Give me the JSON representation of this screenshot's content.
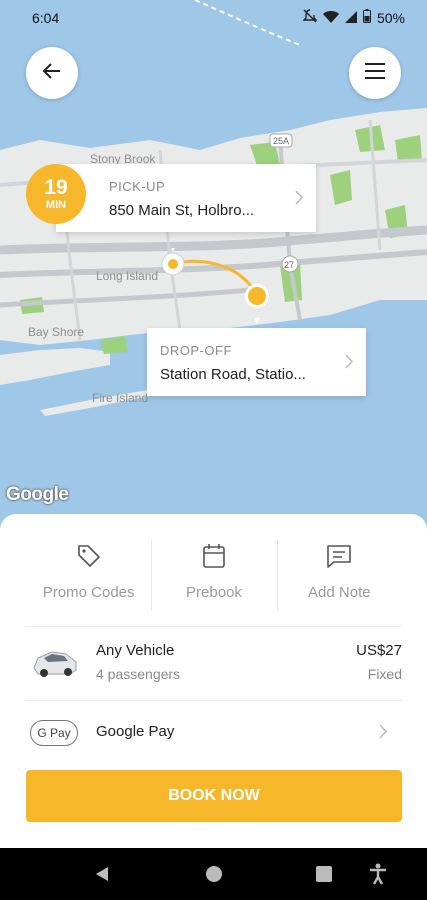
{
  "status_bar": {
    "time": "6:04",
    "battery": "50%"
  },
  "trip": {
    "eta_value": "19",
    "eta_unit": "MIN",
    "pickup_label": "PICK-UP",
    "pickup_address": "850 Main St, Holbro...",
    "dropoff_label": "DROP-OFF",
    "dropoff_address": "Station Road, Statio..."
  },
  "map": {
    "attribution": "Google",
    "place_labels": [
      "Stony Brook",
      "Long Island",
      "Bay Shore",
      "Fire Island"
    ],
    "route_shields": [
      "25A",
      "27"
    ],
    "colors": {
      "water": "#9fc7e8",
      "land": "#e9eaea",
      "parks": "#9dd17d",
      "roads": "#c5c8cc",
      "route": "#f6b72b"
    }
  },
  "actions": [
    {
      "label": "Promo Codes",
      "icon": "tag-icon"
    },
    {
      "label": "Prebook",
      "icon": "calendar-icon"
    },
    {
      "label": "Add Note",
      "icon": "note-icon"
    }
  ],
  "vehicle": {
    "name": "Any Vehicle",
    "passengers": "4 passengers",
    "price": "US$27",
    "price_type": "Fixed",
    "icon": "car-icon"
  },
  "payment": {
    "badge": "G Pay",
    "name": "Google Pay"
  },
  "book_button": "BOOK NOW",
  "colors": {
    "accent": "#f6b72b"
  }
}
